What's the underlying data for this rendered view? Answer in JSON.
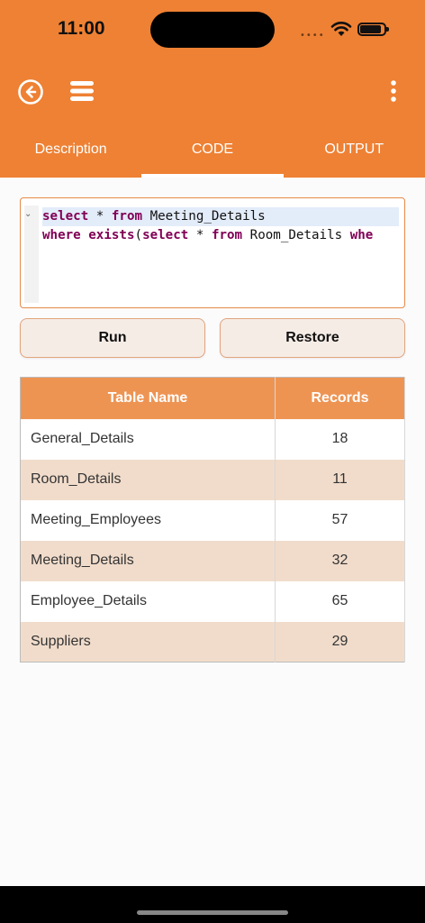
{
  "status_bar": {
    "time": "11:00",
    "signal_dots": "••••"
  },
  "tabs": [
    {
      "label": "Description",
      "active": false
    },
    {
      "label": "CODE",
      "active": true
    },
    {
      "label": "OUTPUT",
      "active": false
    }
  ],
  "editor": {
    "line1": {
      "kw1": "select",
      "t1": " * ",
      "kw2": "from",
      "t2": " Meeting_Details"
    },
    "line2": {
      "kw1": "where",
      "t1": " ",
      "kw2": "exists",
      "t2": "(",
      "kw3": "select",
      "t3": " * ",
      "kw4": "from",
      "t4": " Room_Details ",
      "kw5": "whe"
    }
  },
  "buttons": {
    "run": "Run",
    "restore": "Restore"
  },
  "table": {
    "headers": [
      "Table Name",
      "Records"
    ],
    "rows": [
      {
        "name": "General_Details",
        "records": "18"
      },
      {
        "name": "Room_Details",
        "records": "11"
      },
      {
        "name": "Meeting_Employees",
        "records": "57"
      },
      {
        "name": "Meeting_Details",
        "records": "32"
      },
      {
        "name": "Employee_Details",
        "records": "65"
      },
      {
        "name": "Suppliers",
        "records": "29"
      }
    ]
  },
  "colors": {
    "accent": "#ee8134",
    "table_header": "#ee9453",
    "row_alt": "#f1dccb"
  },
  "icons": {
    "back": "back-circle-icon",
    "menu": "hamburger-menu-icon",
    "more": "more-vertical-icon",
    "wifi": "wifi-icon",
    "battery": "battery-icon"
  }
}
